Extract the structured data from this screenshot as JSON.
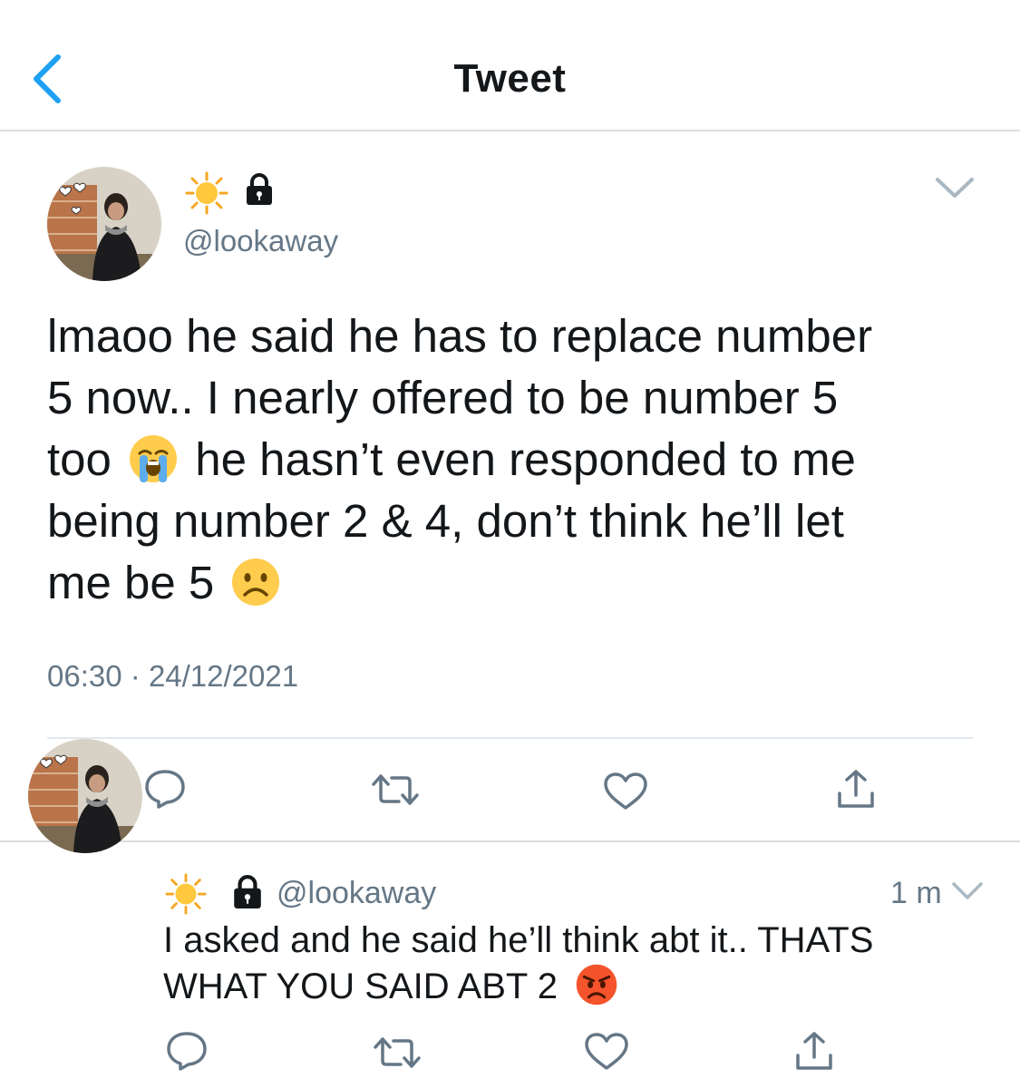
{
  "header": {
    "title": "Tweet"
  },
  "main_tweet": {
    "name_emoji": "sun",
    "protected": true,
    "handle": "@lookaway",
    "line1": "lmaoo he said he has to replace number",
    "line2": "5 now.. I nearly offered to be number 5",
    "line3a": "too",
    "line3_emoji": "loudly-crying-face",
    "line3b": "he hasn’t even responded to me",
    "line4": "being number 2 & 4, don’t think he’ll let",
    "line5": "me be 5",
    "line5_emoji": "frowning-face",
    "time": "06:30",
    "date_sep": "·",
    "date": "24/12/2021"
  },
  "reply_tweet": {
    "name_emoji": "sun",
    "protected": true,
    "handle": "@lookaway",
    "age": "1 m",
    "line1": "I asked and he said he’ll think abt it.. THATS",
    "line2": "WHAT YOU SAID ABT 2",
    "line2_emoji": "pouting-face"
  },
  "actions": [
    "reply-icon",
    "retweet-icon",
    "like-icon",
    "share-icon"
  ],
  "colors": {
    "accent": "#1da1f2",
    "secondary_text": "#657786",
    "divider": "#d9dde1"
  }
}
